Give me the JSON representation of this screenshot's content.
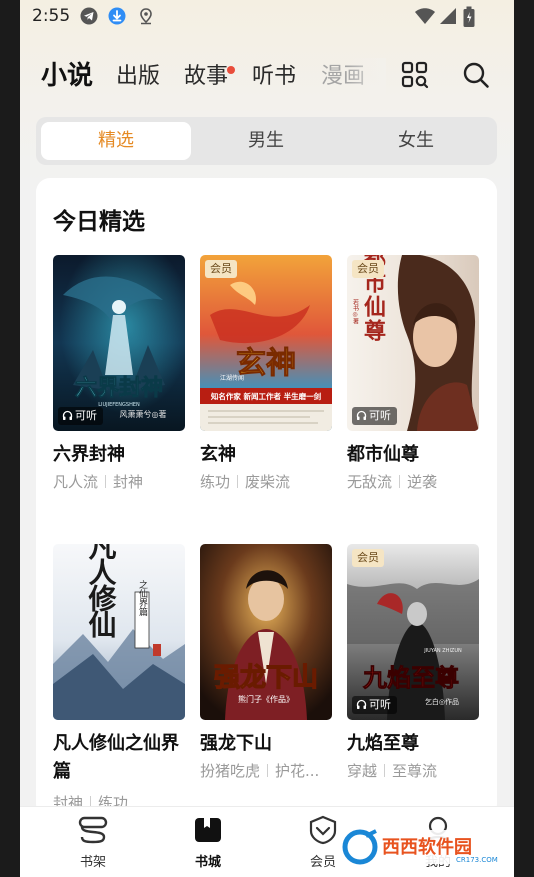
{
  "status_bar": {
    "time": "2:55"
  },
  "top_nav": {
    "tabs": [
      {
        "label": "小说",
        "active": true
      },
      {
        "label": "出版"
      },
      {
        "label": "故事",
        "dot": true
      },
      {
        "label": "听书"
      },
      {
        "label": "漫画"
      }
    ]
  },
  "segment": {
    "items": [
      "精选",
      "男生",
      "女生"
    ],
    "selected": "精选"
  },
  "section": {
    "title": "今日精选",
    "books": [
      {
        "title": "六界封神",
        "tags": [
          "凡人流",
          "封神"
        ],
        "vip": false,
        "listen": true,
        "vip_label": "",
        "listen_label": "可听"
      },
      {
        "title": "玄神",
        "tags": [
          "练功",
          "废柴流"
        ],
        "vip": true,
        "listen": false,
        "vip_label": "会员",
        "listen_label": ""
      },
      {
        "title": "都市仙尊",
        "tags": [
          "无敌流",
          "逆袭"
        ],
        "vip": true,
        "listen": true,
        "vip_label": "会员",
        "listen_label": "可听"
      },
      {
        "title": "凡人修仙之仙界篇",
        "tags": [
          "封神",
          "练功"
        ],
        "vip": false,
        "listen": false,
        "vip_label": "",
        "listen_label": ""
      },
      {
        "title": "强龙下山",
        "tags": [
          "扮猪吃虎",
          "护花..."
        ],
        "vip": false,
        "listen": false,
        "vip_label": "",
        "listen_label": ""
      },
      {
        "title": "九焰至尊",
        "tags": [
          "穿越",
          "至尊流"
        ],
        "vip": true,
        "listen": true,
        "vip_label": "会员",
        "listen_label": "可听"
      }
    ]
  },
  "covers": {
    "c1": {
      "art": "六界封神",
      "sub": "LIUJIEFENGSHEN",
      "author": "风萧萧兮◎著"
    },
    "c2": {
      "art": "玄神",
      "banner": "知名作家 新闻工作者 半生磨一剑",
      "strip": "江湖传闻"
    },
    "c3": {
      "art": "都市仙尊",
      "author": "若书◎著"
    },
    "c4": {
      "art": "凡人修仙",
      "side": "之仙界篇"
    },
    "c5": {
      "art": "强龙下山",
      "author": "熊门子《作品》"
    },
    "c6": {
      "art": "九焰至尊",
      "sub": "JIUYAN ZHIZUN",
      "author": "乞白◎作品"
    }
  },
  "bottom_nav": {
    "items": [
      {
        "label": "书架",
        "icon": "bookshelf-icon"
      },
      {
        "label": "书城",
        "icon": "bookstore-icon",
        "active": true
      },
      {
        "label": "会员",
        "icon": "vip-shield-icon"
      },
      {
        "label": "我的",
        "icon": "profile-icon"
      }
    ]
  },
  "watermark": {
    "brand": "西西软件园",
    "url": "CR173.COM"
  },
  "colors": {
    "accent": "#e58a24",
    "badge_red": "#e94d3b",
    "vip_bg": "#f5e5c4"
  }
}
